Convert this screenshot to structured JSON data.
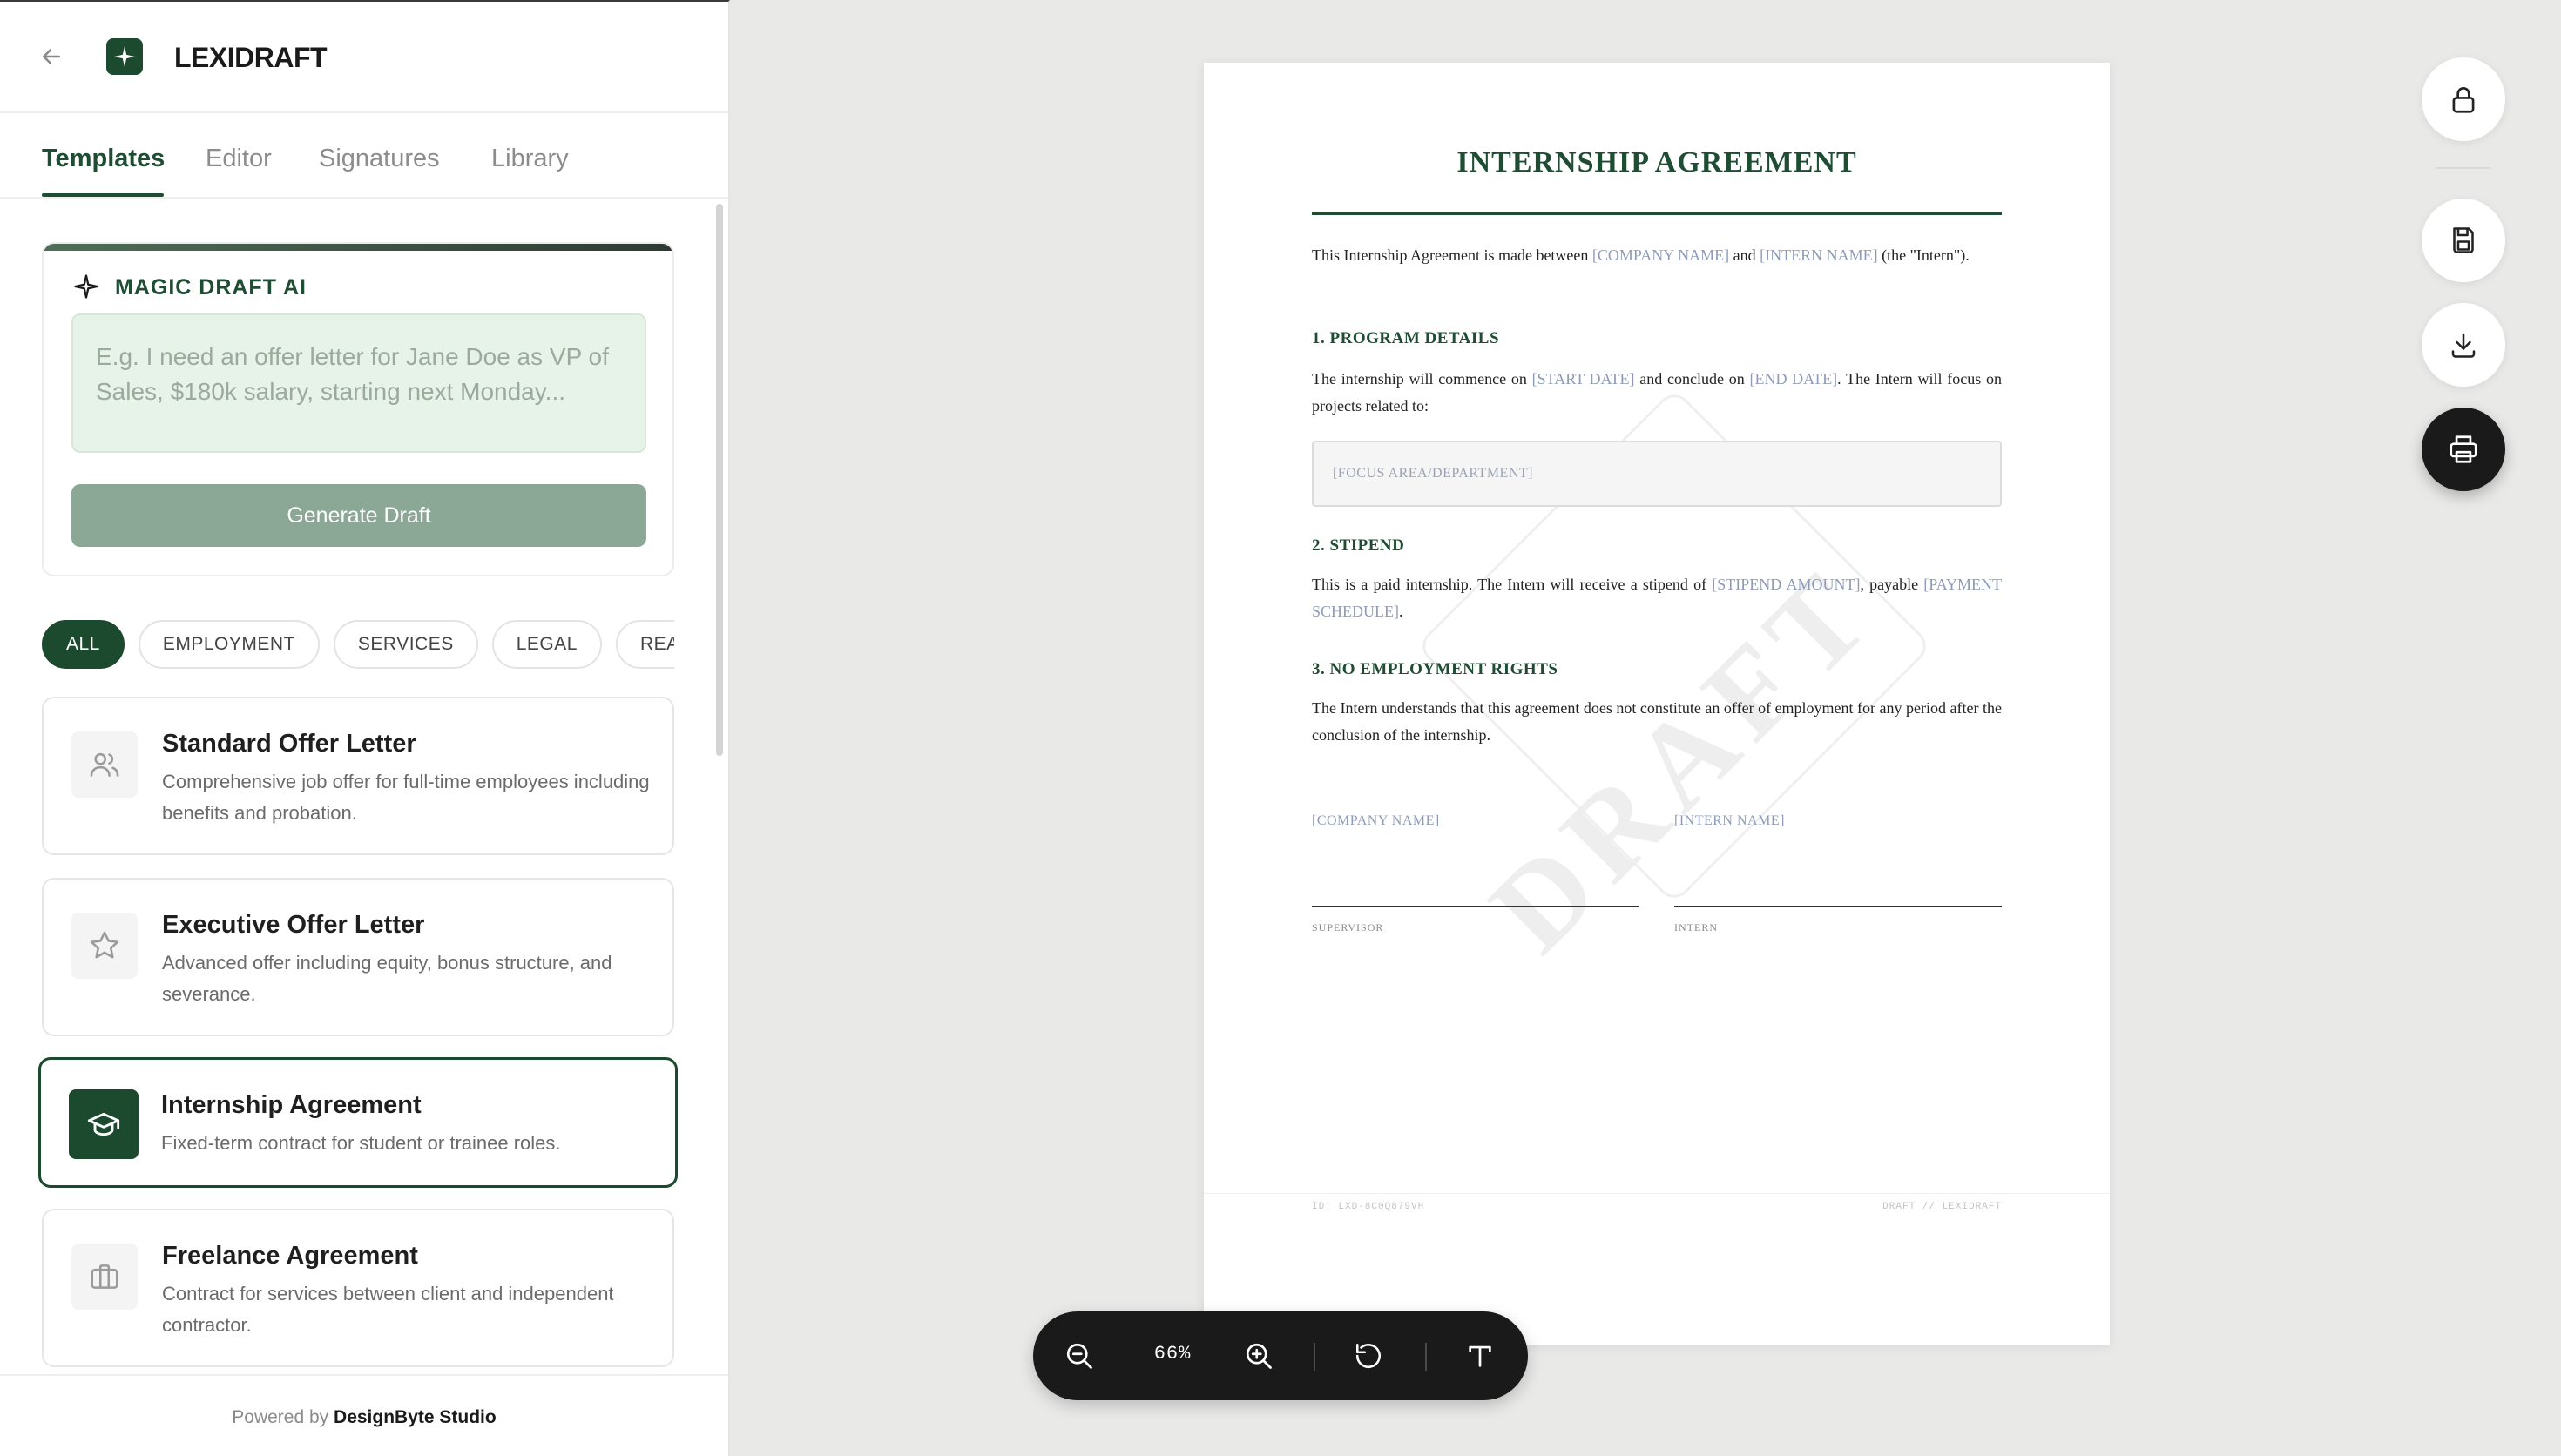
{
  "brand": {
    "name": "LEXIDRAFT"
  },
  "tabs": [
    {
      "label": "Templates",
      "active": true
    },
    {
      "label": "Editor",
      "active": false
    },
    {
      "label": "Signatures",
      "active": false
    },
    {
      "label": "Library",
      "active": false
    }
  ],
  "ai": {
    "title": "MAGIC DRAFT AI",
    "placeholder": "E.g. I need an offer letter for Jane Doe as VP of Sales, $180k salary, starting next Monday...",
    "button": "Generate Draft"
  },
  "filters": [
    "ALL",
    "EMPLOYMENT",
    "SERVICES",
    "LEGAL",
    "REAL EST"
  ],
  "templates": [
    {
      "title": "Standard Offer Letter",
      "desc": "Comprehensive job offer for full-time employees including benefits and probation.",
      "icon": "users-icon"
    },
    {
      "title": "Executive Offer Letter",
      "desc": "Advanced offer including equity, bonus structure, and severance.",
      "icon": "star-icon"
    },
    {
      "title": "Internship Agreement",
      "desc": "Fixed-term contract for student or trainee roles.",
      "icon": "graduation-cap-icon",
      "selected": true
    },
    {
      "title": "Freelance Agreement",
      "desc": "Contract for services between client and independent contractor.",
      "icon": "briefcase-icon"
    }
  ],
  "footer": {
    "powered_prefix": "Powered by",
    "powered_by": "DesignByte Studio"
  },
  "document": {
    "title": "INTERNSHIP AGREEMENT",
    "intro": {
      "t1": "This Internship Agreement is made between ",
      "company": "[COMPANY NAME]",
      "t2": " and ",
      "intern": "[INTERN NAME]",
      "t3": " (the \"Intern\")."
    },
    "s1_heading": "1. PROGRAM DETAILS",
    "s1": {
      "t1": "The internship will commence on ",
      "start": "[START DATE]",
      "t2": " and conclude on ",
      "end": "[END DATE]",
      "t3": ". The Intern will focus on projects related to:"
    },
    "focus_placeholder": "[FOCUS AREA/DEPARTMENT]",
    "s2_heading": "2. STIPEND",
    "s2": {
      "t1": "This is a paid internship. The Intern will receive a stipend of ",
      "amount": "[STIPEND AMOUNT]",
      "t2": ", payable ",
      "schedule": "[PAYMENT SCHEDULE]",
      "t3": "."
    },
    "s3_heading": "3. NO EMPLOYMENT RIGHTS",
    "s3": "The Intern understands that this agreement does not constitute an offer of employment for any period after the conclusion of the internship.",
    "sig_left_name": "[COMPANY NAME]",
    "sig_left_role": "SUPERVISOR",
    "sig_right_name": "[INTERN NAME]",
    "sig_right_role": "INTERN",
    "watermark": "DRAFT",
    "footer_left": "ID: LXD-8C0Q879VH",
    "footer_right": "DRAFT // LEXIDRAFT"
  },
  "zoom": {
    "value": "66%"
  },
  "colors": {
    "accent": "#1c4a2f",
    "placeholder": "#8e9bb8",
    "toolbar": "#1a1a1a"
  }
}
